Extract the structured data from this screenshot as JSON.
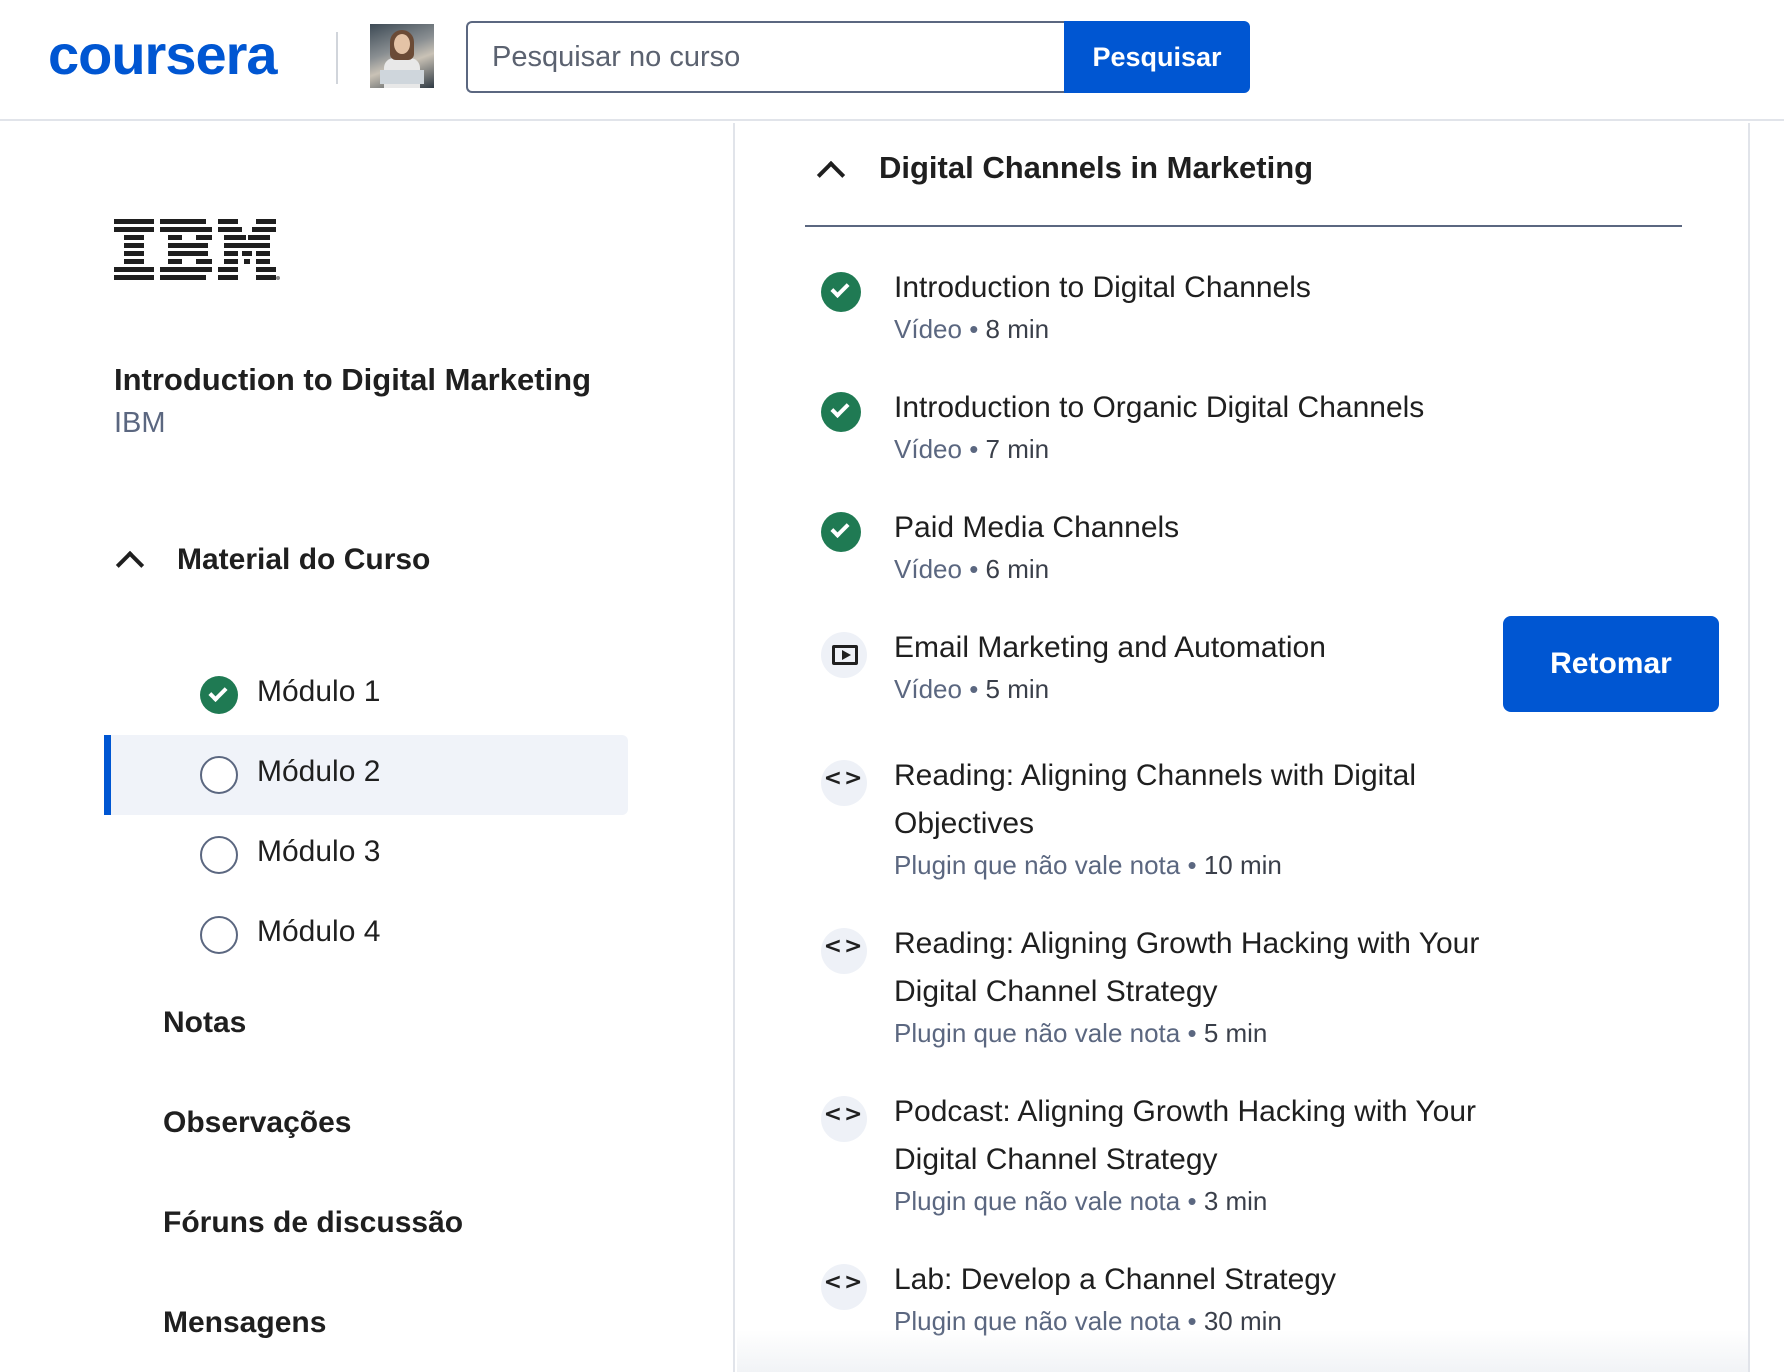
{
  "header": {
    "logo": "coursera",
    "search_placeholder": "Pesquisar no curso",
    "search_button": "Pesquisar"
  },
  "sidebar": {
    "course_title": "Introduction to Digital Marketing",
    "course_org": "IBM",
    "ibm_logo_text": "IBM",
    "material_label": "Material do Curso",
    "modules": [
      {
        "label": "Módulo 1",
        "status": "completed"
      },
      {
        "label": "Módulo 2",
        "status": "current"
      },
      {
        "label": "Módulo 3",
        "status": "not-started"
      },
      {
        "label": "Módulo 4",
        "status": "not-started"
      }
    ],
    "links": [
      "Notas",
      "Observações",
      "Fóruns de discussão",
      "Mensagens"
    ]
  },
  "main": {
    "section_title": "Digital Channels in Marketing",
    "resume_button": "Retomar",
    "lessons": [
      {
        "title": "Introduction to Digital Channels",
        "type": "Vídeo",
        "duration": "8 min",
        "icon": "check-icon",
        "status": "completed"
      },
      {
        "title": "Introduction to Organic Digital Channels",
        "type": "Vídeo",
        "duration": "7 min",
        "icon": "check-icon",
        "status": "completed"
      },
      {
        "title": "Paid Media Channels",
        "type": "Vídeo",
        "duration": "6 min",
        "icon": "check-icon",
        "status": "completed"
      },
      {
        "title": "Email Marketing and Automation",
        "type": "Vídeo",
        "duration": "5 min",
        "icon": "video-icon",
        "status": "in-progress"
      },
      {
        "title_line1": "Reading: Aligning Channels with Digital",
        "title_line2": "Objectives",
        "type": "Plugin que não vale nota",
        "duration": "10 min",
        "icon": "code-icon"
      },
      {
        "title_line1": "Reading: Aligning Growth Hacking with Your",
        "title_line2": "Digital Channel Strategy",
        "type": "Plugin que não vale nota",
        "duration": "5 min",
        "icon": "code-icon"
      },
      {
        "title_line1": "Podcast: Aligning Growth Hacking with Your",
        "title_line2": "Digital Channel Strategy",
        "type": "Plugin que não vale nota",
        "duration": "3 min",
        "icon": "code-icon"
      },
      {
        "title": "Lab: Develop a Channel Strategy",
        "type": "Plugin que não vale nota",
        "duration": "30 min",
        "icon": "code-icon"
      }
    ],
    "separator": "•"
  },
  "colors": {
    "brand": "#0056d2",
    "success": "#1f7a53",
    "muted_text": "#5b6780",
    "active_bg": "#f0f3f9"
  }
}
